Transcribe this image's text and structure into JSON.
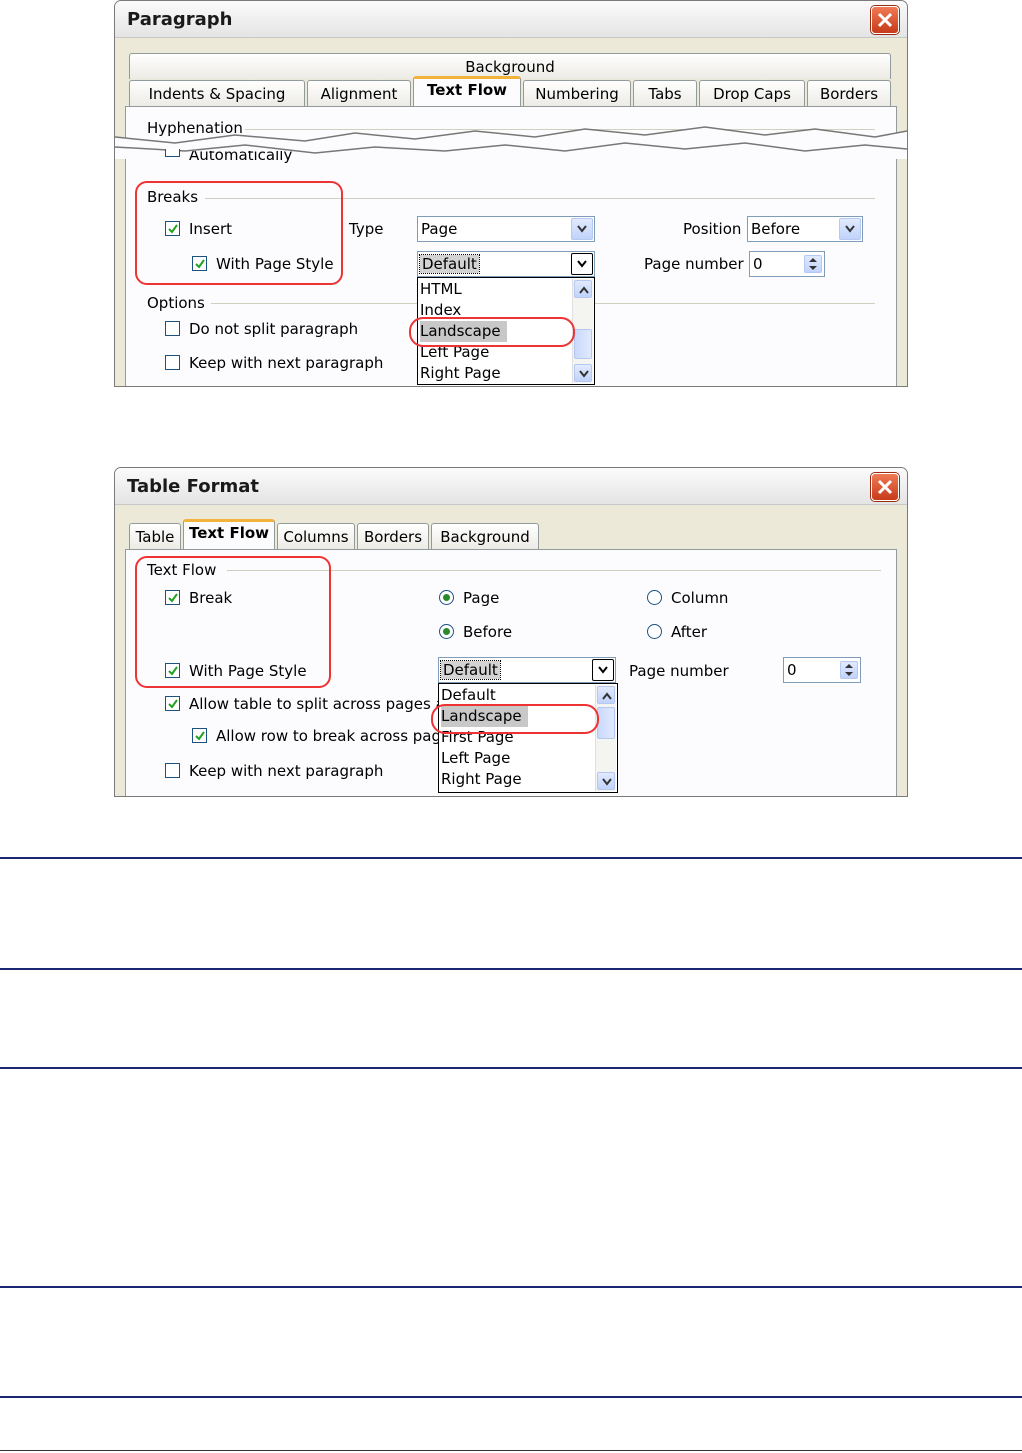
{
  "paragraph_dialog": {
    "title": "Paragraph",
    "tab_top": "Background",
    "tabs": [
      "Indents & Spacing",
      "Alignment",
      "Text Flow",
      "Numbering",
      "Tabs",
      "Drop Caps",
      "Borders"
    ],
    "active_tab": "Text Flow",
    "hyphenation_label": "Hyphenation",
    "automatically_label": "Automatically",
    "breaks_label": "Breaks",
    "insert_label": "Insert",
    "with_page_style_label": "With Page Style",
    "type_label": "Type",
    "type_value": "Page",
    "position_label": "Position",
    "position_value": "Before",
    "page_style_value": "Default",
    "page_number_label": "Page number",
    "page_number_value": "0",
    "options_label": "Options",
    "do_not_split_label": "Do not split paragraph",
    "keep_with_next_label": "Keep with next paragraph",
    "dropdown_items": [
      "HTML",
      "Index",
      "Landscape",
      "Left Page",
      "Right Page"
    ],
    "dropdown_highlighted": "Landscape"
  },
  "table_dialog": {
    "title": "Table Format",
    "tabs": [
      "Table",
      "Text Flow",
      "Columns",
      "Borders",
      "Background"
    ],
    "active_tab": "Text Flow",
    "text_flow_label": "Text Flow",
    "break_label": "Break",
    "page_label": "Page",
    "column_label": "Column",
    "before_label": "Before",
    "after_label": "After",
    "with_page_style_label": "With Page Style",
    "page_style_value": "Default",
    "page_number_label": "Page number",
    "page_number_value": "0",
    "allow_split_label": "Allow table to split across pages and",
    "allow_row_break_label": "Allow row to break across pages",
    "keep_with_next_label": "Keep with next paragraph",
    "dropdown_items": [
      "Default",
      "Landscape",
      "First Page",
      "Left Page",
      "Right Page"
    ],
    "dropdown_highlighted": "Landscape"
  },
  "colors": {
    "highlight_red": "#ee3333",
    "rule_blue": "#1a2770",
    "dialog_bg": "#ece9d8"
  }
}
